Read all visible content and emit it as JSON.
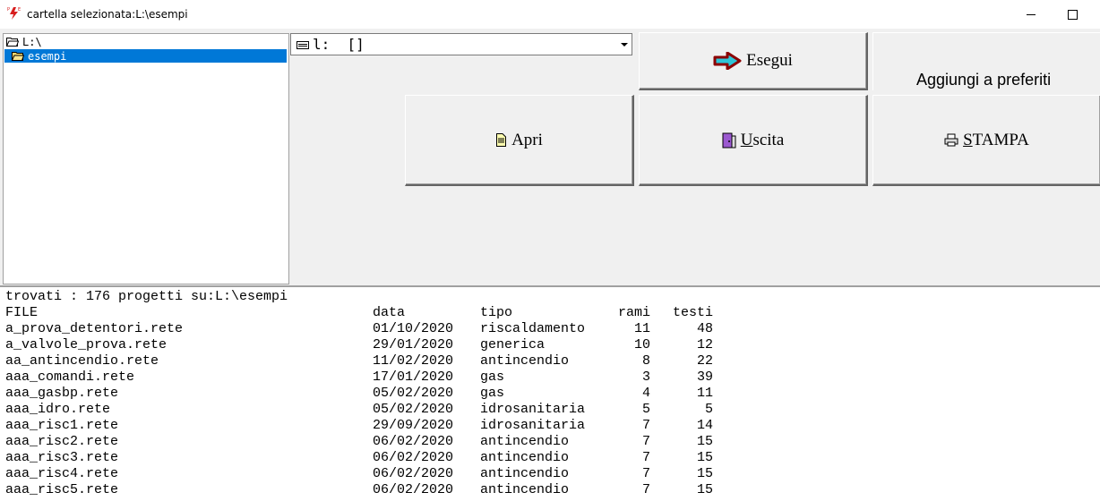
{
  "window": {
    "title": "cartella selezionata:L:\\esempi",
    "icon": "app-logo-icon"
  },
  "tree": {
    "root_label": "L:\\",
    "child_label": "esempi",
    "selected_color": "#0078d7"
  },
  "drive_combo": {
    "value": "l:  []"
  },
  "buttons": {
    "esegui": "Esegui",
    "preferiti": "Aggiungi a preferiti",
    "apri": "Apri",
    "uscita_u": "U",
    "uscita_rest": "scita",
    "stampa_u": "S",
    "stampa_rest": "TAMPA"
  },
  "listing": {
    "summary": "trovati : 176 progetti su:L:\\esempi",
    "headers": {
      "file": "FILE",
      "data": "data",
      "tipo": "tipo",
      "rami": "rami",
      "testi": "testi"
    },
    "rows": [
      {
        "file": "a_prova_detentori.rete",
        "data": "01/10/2020",
        "tipo": "riscaldamento",
        "rami": "11",
        "testi": "48"
      },
      {
        "file": "a_valvole_prova.rete",
        "data": "29/01/2020",
        "tipo": "generica",
        "rami": "10",
        "testi": "12"
      },
      {
        "file": "aa_antincendio.rete",
        "data": "11/02/2020",
        "tipo": "antincendio",
        "rami": "8",
        "testi": "22"
      },
      {
        "file": "aaa_comandi.rete",
        "data": "17/01/2020",
        "tipo": "gas",
        "rami": "3",
        "testi": "39"
      },
      {
        "file": "aaa_gasbp.rete",
        "data": "05/02/2020",
        "tipo": "gas",
        "rami": "4",
        "testi": "11"
      },
      {
        "file": "aaa_idro.rete",
        "data": "05/02/2020",
        "tipo": "idrosanitaria",
        "rami": "5",
        "testi": "5"
      },
      {
        "file": "aaa_risc1.rete",
        "data": "29/09/2020",
        "tipo": "idrosanitaria",
        "rami": "7",
        "testi": "14"
      },
      {
        "file": "aaa_risc2.rete",
        "data": "06/02/2020",
        "tipo": "antincendio",
        "rami": "7",
        "testi": "15"
      },
      {
        "file": "aaa_risc3.rete",
        "data": "06/02/2020",
        "tipo": "antincendio",
        "rami": "7",
        "testi": "15"
      },
      {
        "file": "aaa_risc4.rete",
        "data": "06/02/2020",
        "tipo": "antincendio",
        "rami": "7",
        "testi": "15"
      },
      {
        "file": "aaa_risc5.rete",
        "data": "06/02/2020",
        "tipo": "antincendio",
        "rami": "7",
        "testi": "15"
      }
    ]
  }
}
